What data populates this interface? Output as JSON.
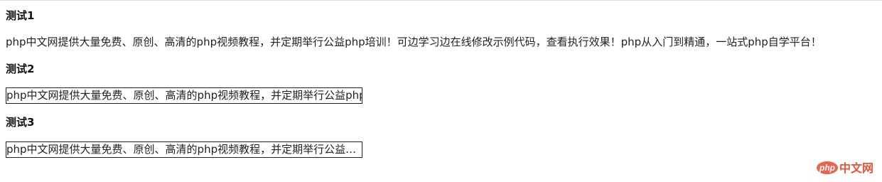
{
  "sections": [
    {
      "heading": "测试1",
      "text": "php中文网提供大量免费、原创、高清的php视频教程，并定期举行公益php培训！可边学习边在线修改示例代码，查看执行效果！php从入门到精通，一站式php自学平台！"
    },
    {
      "heading": "测试2",
      "text": "php中文网提供大量免费、原创、高清的php视频教程，并定期举行公益php培训！可边学习边在线修改示例代码，查看执行效果！php从入门到精通，一站式php自学平台！"
    },
    {
      "heading": "测试3",
      "text": "php中文网提供大量免费、原创、高清的php视频教程，并定期举行公益php培训！可边学习边在线修改示例代码，查看执行效果！php从入门到精通，一站式php自学平台！"
    }
  ],
  "watermark": {
    "brand_text": "php",
    "site_text": "中文网",
    "color": "#e8533a"
  }
}
